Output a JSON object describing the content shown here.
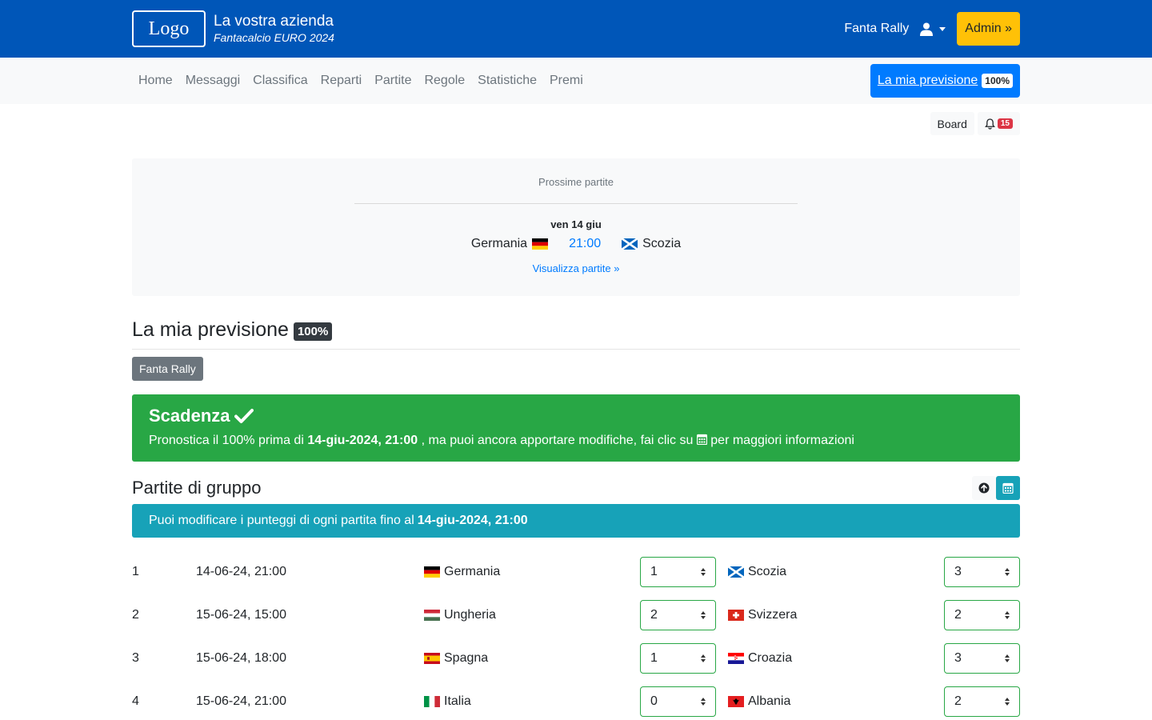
{
  "header": {
    "logo": "Logo",
    "company": "La vostra azienda",
    "subtitle": "Fantacalcio EURO 2024",
    "user": "Fanta Rally",
    "admin": "Admin »"
  },
  "nav": {
    "links": [
      "Home",
      "Messaggi",
      "Classifica",
      "Reparti",
      "Partite",
      "Regole",
      "Statistiche",
      "Premi"
    ],
    "prediction_label": "La mia previsione",
    "prediction_badge": "100%"
  },
  "toolbar": {
    "board": "Board",
    "notifications": "15"
  },
  "upcoming": {
    "heading": "Prossime partite",
    "date": "ven 14 giu",
    "home": "Germania",
    "time": "21:00",
    "away": "Scozia",
    "link": "Visualizza partite »"
  },
  "prediction": {
    "title": "La mia previsione",
    "badge": "100%",
    "user": "Fanta Rally"
  },
  "deadline": {
    "title": "Scadenza",
    "msg_a": "Pronostica il 100% prima di",
    "msg_date": "14-giu-2024, 21:00",
    "msg_b": ", ma puoi ancora apportare modifiche, fai clic su",
    "msg_c": "per maggiori informazioni"
  },
  "group": {
    "title": "Partite di gruppo",
    "info_a": "Puoi modificare i punteggi di ogni partita fino al",
    "info_date": "14-giu-2024, 21:00"
  },
  "matches": [
    {
      "num": "1",
      "date": "14-06-24, 21:00",
      "home": "Germania",
      "home_score": "1",
      "away": "Scozia",
      "away_score": "3"
    },
    {
      "num": "2",
      "date": "15-06-24, 15:00",
      "home": "Ungheria",
      "home_score": "2",
      "away": "Svizzera",
      "away_score": "2"
    },
    {
      "num": "3",
      "date": "15-06-24, 18:00",
      "home": "Spagna",
      "home_score": "1",
      "away": "Croazia",
      "away_score": "3"
    },
    {
      "num": "4",
      "date": "15-06-24, 21:00",
      "home": "Italia",
      "home_score": "0",
      "away": "Albania",
      "away_score": "2"
    }
  ],
  "colors": {
    "header": "#0056b8",
    "accent": "#007bff",
    "success": "#28a745",
    "info": "#17a2b8",
    "warning": "#ffc107"
  }
}
